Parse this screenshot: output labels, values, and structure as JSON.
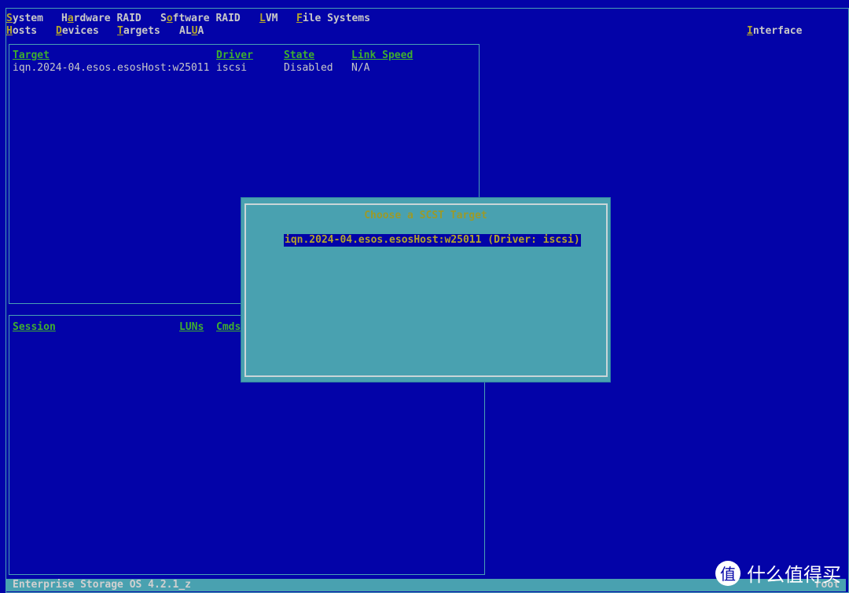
{
  "menu": {
    "row1": [
      {
        "pre": "",
        "hot": "S",
        "post": "ystem"
      },
      {
        "pre": "H",
        "hot": "a",
        "post": "rdware RAID"
      },
      {
        "pre": "S",
        "hot": "o",
        "post": "ftware RAID"
      },
      {
        "pre": "",
        "hot": "L",
        "post": "VM"
      },
      {
        "pre": "",
        "hot": "F",
        "post": "ile Systems"
      }
    ],
    "row2": [
      {
        "pre": "",
        "hot": "H",
        "post": "osts"
      },
      {
        "pre": "",
        "hot": "D",
        "post": "evices"
      },
      {
        "pre": "",
        "hot": "T",
        "post": "argets"
      },
      {
        "pre": "AL",
        "hot": "U",
        "post": "A"
      }
    ],
    "interface": {
      "pre": "",
      "hot": "I",
      "post": "nterface"
    }
  },
  "targets_panel": {
    "headers": [
      "Target",
      "Driver",
      "State",
      "Link Speed"
    ],
    "rows": [
      [
        "iqn.2024-04.esos.esosHost:w25011",
        "iscsi",
        "Disabled",
        "N/A"
      ]
    ]
  },
  "sessions_panel": {
    "headers": [
      "Session",
      "LUNs",
      "Cmds"
    ]
  },
  "dialog": {
    "title": "Choose a SCST Target",
    "items": [
      "iqn.2024-04.esos.esosHost:w25011 (Driver: iscsi)"
    ]
  },
  "status_bar": {
    "left": "Enterprise Storage OS 4.2.1_z",
    "right": "root"
  },
  "watermark": {
    "icon": "值",
    "text": "什么值得买"
  },
  "colors": {
    "background": "#0303a8",
    "dialog": "#49a1b0",
    "header": "#3fae2f",
    "hotkey": "#b5a52a"
  }
}
